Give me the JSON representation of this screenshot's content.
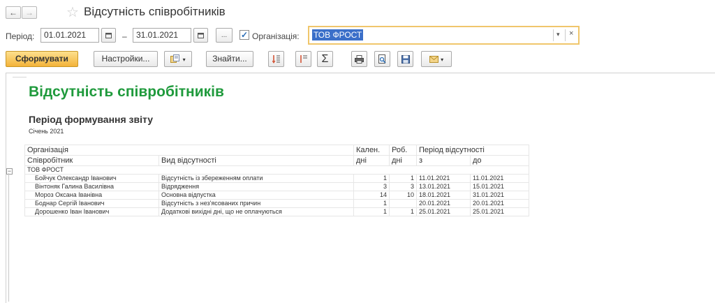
{
  "window": {
    "title": "Відсутність співробітників"
  },
  "params": {
    "period_label": "Період:",
    "date_from": "01.01.2021",
    "dash": "–",
    "date_to": "31.01.2021",
    "more_label": "...",
    "org_checkbox_checked": true,
    "org_label": "Організація:",
    "org_value": "ТОВ ФРОСТ"
  },
  "toolbar": {
    "generate_label": "Сформувати",
    "settings_label": "Настройки...",
    "find_label": "Знайти...",
    "sum_label": "Σ"
  },
  "report": {
    "title": "Відсутність співробітників",
    "subtitle": "Період формування звіту",
    "period": "Січень 2021",
    "headers": {
      "org": "Організація",
      "employee": "Співробітник",
      "absence_type": "Вид відсутності",
      "cal": "Кален.",
      "cal_days": "дні",
      "work": "Роб.",
      "work_days": "дні",
      "period": "Період відсутності",
      "from": "з",
      "to": "до"
    },
    "group": "ТОВ ФРОСТ",
    "rows": [
      {
        "employee": "Бойчук Олександр Іванович",
        "type": "Відсутність із збереженням оплати",
        "cal": "1",
        "work": "1",
        "from": "11.01.2021",
        "to": "11.01.2021"
      },
      {
        "employee": "Вінтоняк Галина Василівна",
        "type": "Відрядження",
        "cal": "3",
        "work": "3",
        "from": "13.01.2021",
        "to": "15.01.2021"
      },
      {
        "employee": "Мороз Оксана Іванівна",
        "type": "Основна відпустка",
        "cal": "14",
        "work": "10",
        "from": "18.01.2021",
        "to": "31.01.2021"
      },
      {
        "employee": "Боднар Сергій Іванович",
        "type": "Відсутність з нез'ясованих причин",
        "cal": "1",
        "work": "",
        "from": "20.01.2021",
        "to": "20.01.2021"
      },
      {
        "employee": "Дорошенко Іван Іванович",
        "type": "Додаткові вихідні дні, що не оплачуються",
        "cal": "1",
        "work": "1",
        "from": "25.01.2021",
        "to": "25.01.2021"
      }
    ]
  },
  "colors": {
    "accent": "#f3b33a",
    "title_green": "#1f9a3c",
    "selection": "#3b6fc9"
  }
}
